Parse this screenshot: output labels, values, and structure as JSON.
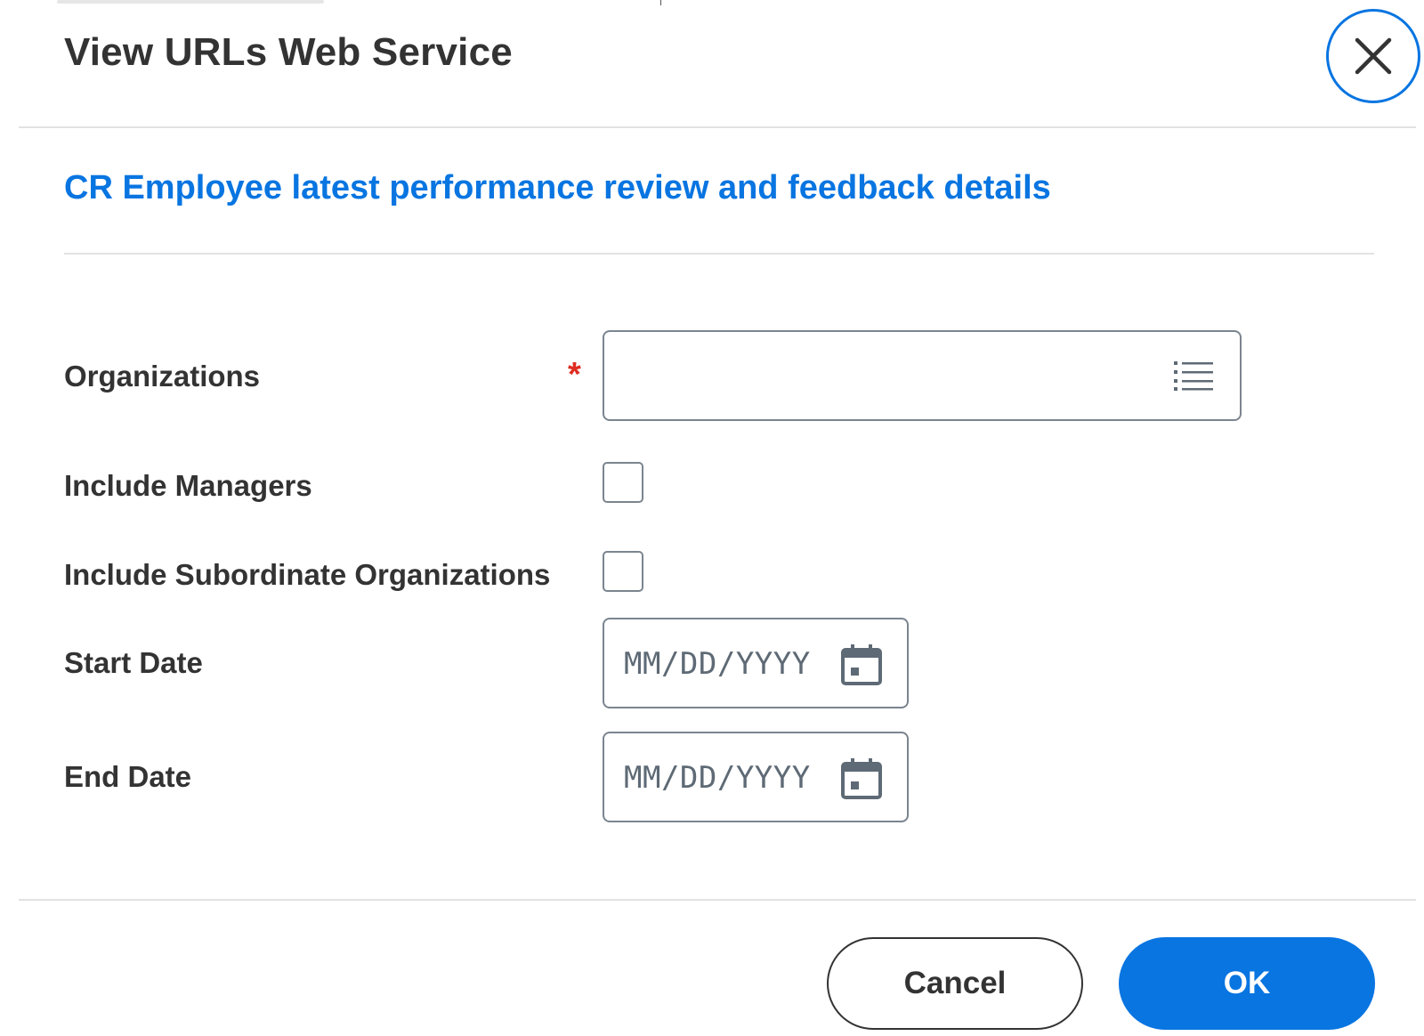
{
  "header": {
    "title": "View URLs Web Service",
    "close_icon": "close-icon"
  },
  "report": {
    "link_text": "CR Employee latest performance review and feedback details"
  },
  "form": {
    "organizations": {
      "label": "Organizations",
      "required_marker": "*",
      "value": "",
      "icon": "list-icon"
    },
    "include_managers": {
      "label": "Include Managers",
      "checked": false
    },
    "include_subordinate_organizations": {
      "label": "Include Subordinate Organizations",
      "checked": false
    },
    "start_date": {
      "label": "Start Date",
      "placeholder": "MM/DD/YYYY",
      "icon": "calendar-icon"
    },
    "end_date": {
      "label": "End Date",
      "placeholder": "MM/DD/YYYY",
      "icon": "calendar-icon"
    }
  },
  "footer": {
    "cancel_label": "Cancel",
    "ok_label": "OK"
  },
  "colors": {
    "accent": "#0875e1",
    "required": "#de2e21",
    "text": "#333333",
    "border": "#7b858f",
    "divider": "#e2e2e2"
  }
}
